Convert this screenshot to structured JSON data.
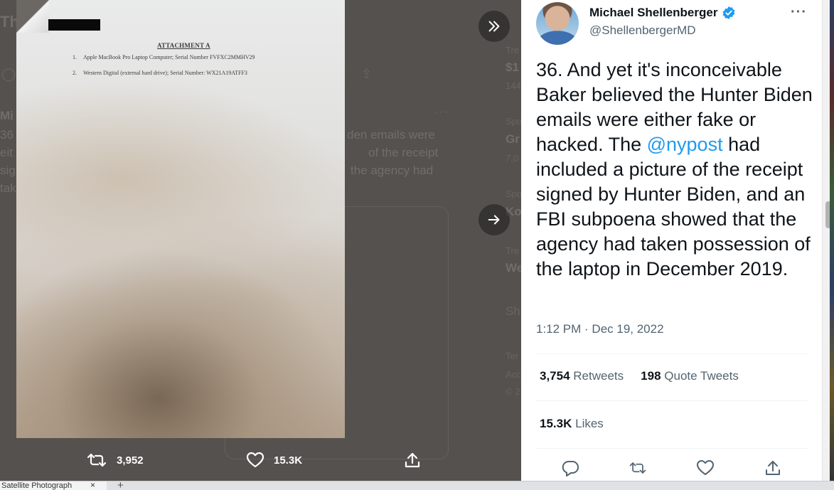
{
  "background_page": {
    "ghost_title": "Th",
    "ghost_author": "Mi",
    "ghost_lines_left": [
      "36",
      "eit",
      "sig",
      "tak"
    ],
    "ghost_lines_right": [
      "den emails were",
      "of the receipt",
      "the agency had"
    ],
    "ghost_trend_1_label": "Tre",
    "ghost_trend_1_value": "$1",
    "ghost_trend_1_count": "144",
    "ghost_trend_2_label": "Spo",
    "ghost_trend_2_value": "Gr",
    "ghost_trend_2_count": "7,0",
    "ghost_trend_3_label": "Spo",
    "ghost_trend_3_value": "Ko",
    "ghost_trend_4_label": "Tre",
    "ghost_trend_4_value": "We",
    "ghost_show_more": "Sh",
    "ghost_footer_1": "Ter",
    "ghost_footer_2": "Acc",
    "ghost_footer_3": "© 2"
  },
  "document": {
    "heading": "ATTACHMENT A",
    "items": [
      {
        "num": "1.",
        "text": "Apple MacBook Pro Laptop Computer; Serial Number FVFXC2MMHV29"
      },
      {
        "num": "2.",
        "text": "Western Digital (external hard drive); Serial Number:  WX21A19ATFF3"
      }
    ]
  },
  "media_actions": {
    "retweets": "3,952",
    "likes": "15.3K"
  },
  "tweet": {
    "display_name": "Michael Shellenberger",
    "handle": "@ShellenbergerMD",
    "text_before_mention": "36. And yet it's inconceivable Baker believed the Hunter Biden emails were either fake or hacked. The ",
    "mention": "@nypost",
    "text_after_mention": " had included a picture of the receipt signed by Hunter Biden, and an FBI subpoena showed that the agency had taken possession of the laptop in December 2019.",
    "timestamp": "1:12 PM · Dec 19, 2022",
    "retweets_value": "3,754",
    "retweets_label": "Retweets",
    "quotes_value": "198",
    "quotes_label": "Quote Tweets",
    "likes_value": "15.3K",
    "likes_label": "Likes"
  },
  "browser": {
    "tab_title": "Satellite Photograph"
  },
  "colors": {
    "accent": "#1d9bf0",
    "text_primary": "#0f1419",
    "text_secondary": "#536471",
    "overlay": "#55514e"
  }
}
